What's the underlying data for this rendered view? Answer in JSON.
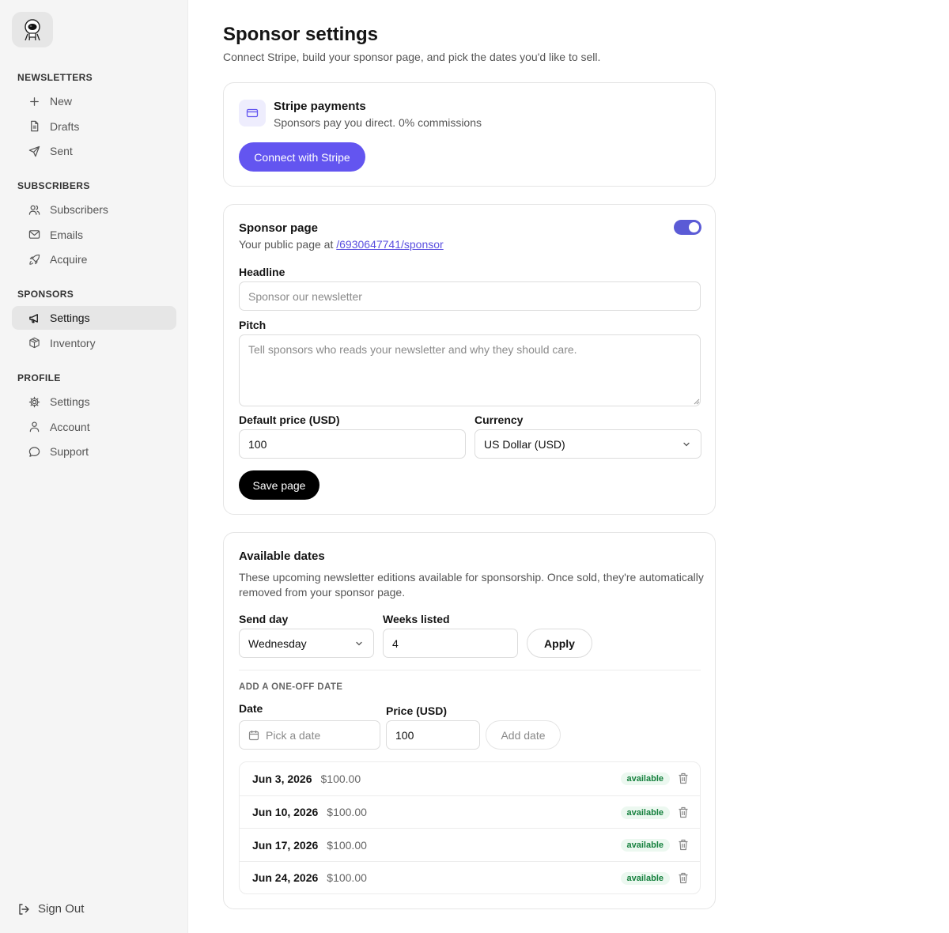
{
  "sidebar": {
    "sections": [
      {
        "heading": "NEWSLETTERS",
        "items": [
          {
            "label": "New",
            "icon": "plus-icon"
          },
          {
            "label": "Drafts",
            "icon": "file-text-icon"
          },
          {
            "label": "Sent",
            "icon": "send-icon"
          }
        ]
      },
      {
        "heading": "SUBSCRIBERS",
        "items": [
          {
            "label": "Subscribers",
            "icon": "users-icon"
          },
          {
            "label": "Emails",
            "icon": "mail-icon"
          },
          {
            "label": "Acquire",
            "icon": "rocket-icon"
          }
        ]
      },
      {
        "heading": "SPONSORS",
        "items": [
          {
            "label": "Settings",
            "icon": "megaphone-icon",
            "active": true
          },
          {
            "label": "Inventory",
            "icon": "package-icon"
          }
        ]
      },
      {
        "heading": "PROFILE",
        "items": [
          {
            "label": "Settings",
            "icon": "gear-icon"
          },
          {
            "label": "Account",
            "icon": "user-icon"
          },
          {
            "label": "Support",
            "icon": "chat-bubble-icon"
          }
        ]
      }
    ],
    "sign_out": "Sign Out"
  },
  "page": {
    "title": "Sponsor settings",
    "subtitle": "Connect Stripe, build your sponsor page, and pick the dates you'd like to sell."
  },
  "stripe": {
    "title": "Stripe payments",
    "subtitle": "Sponsors pay you direct. 0% commissions",
    "button": "Connect with Stripe",
    "accent": "#6355f0"
  },
  "sponsor_page": {
    "title": "Sponsor page",
    "subtitle_prefix": "Your public page at ",
    "link": "/6930647741/sponsor",
    "enabled": true,
    "headline_label": "Headline",
    "headline_placeholder": "Sponsor our newsletter",
    "pitch_label": "Pitch",
    "pitch_placeholder": "Tell sponsors who reads your newsletter and why they should care.",
    "price_label": "Default price (USD)",
    "price_value": "100",
    "currency_label": "Currency",
    "currency_value": "US Dollar (USD)",
    "save_button": "Save page"
  },
  "available_dates": {
    "title": "Available dates",
    "description": "These upcoming newsletter editions available for sponsorship. Once sold, they're automatically removed from your sponsor page.",
    "send_day_label": "Send day",
    "send_day_value": "Wednesday",
    "weeks_label": "Weeks listed",
    "weeks_value": "4",
    "apply_button": "Apply",
    "one_off_heading": "ADD A ONE-OFF DATE",
    "date_label": "Date",
    "date_placeholder": "Pick a date",
    "price_label": "Price (USD)",
    "price_value": "100",
    "add_button": "Add date",
    "rows": [
      {
        "date": "Jun 3, 2026",
        "price": "$100.00",
        "status": "available"
      },
      {
        "date": "Jun 10, 2026",
        "price": "$100.00",
        "status": "available"
      },
      {
        "date": "Jun 17, 2026",
        "price": "$100.00",
        "status": "available"
      },
      {
        "date": "Jun 24, 2026",
        "price": "$100.00",
        "status": "available"
      }
    ]
  }
}
